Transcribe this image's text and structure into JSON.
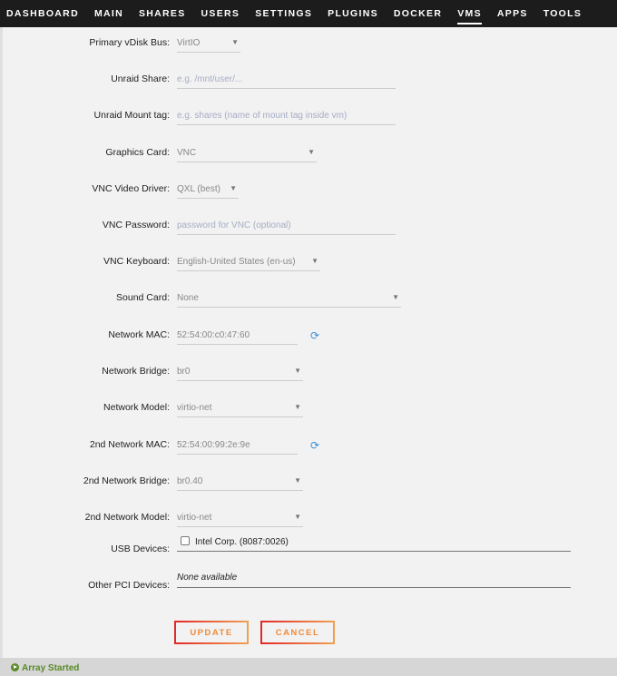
{
  "nav": {
    "items": [
      "DASHBOARD",
      "MAIN",
      "SHARES",
      "USERS",
      "SETTINGS",
      "PLUGINS",
      "DOCKER",
      "VMS",
      "APPS",
      "TOOLS"
    ],
    "active": "VMS"
  },
  "form": {
    "rows": [
      {
        "label": "Primary vDisk Bus:",
        "value": "VirtIO",
        "kind": "select"
      },
      {
        "label": "Unraid Share:",
        "placeholder": "e.g. /mnt/user/...",
        "kind": "input"
      },
      {
        "label": "Unraid Mount tag:",
        "placeholder": "e.g. shares (name of mount tag inside vm)",
        "kind": "input"
      },
      {
        "label": "Graphics Card:",
        "value": "VNC",
        "kind": "select"
      },
      {
        "label": "VNC Video Driver:",
        "value": "QXL (best)",
        "kind": "select"
      },
      {
        "label": "VNC Password:",
        "placeholder": "password for VNC (optional)",
        "kind": "input"
      },
      {
        "label": "VNC Keyboard:",
        "value": "English-United States (en-us)",
        "kind": "select"
      },
      {
        "label": "Sound Card:",
        "value": "None",
        "kind": "select"
      },
      {
        "label": "Network MAC:",
        "value": "52:54:00:c0:47:60",
        "kind": "mac",
        "icon": "refresh-icon"
      },
      {
        "label": "Network Bridge:",
        "value": "br0",
        "kind": "select"
      },
      {
        "label": "Network Model:",
        "value": "virtio-net",
        "kind": "select"
      },
      {
        "label": "2nd Network MAC:",
        "value": "52:54:00:99:2e:9e",
        "kind": "mac",
        "icon": "refresh-icon"
      },
      {
        "label": "2nd Network Bridge:",
        "value": "br0.40",
        "kind": "select"
      },
      {
        "label": "2nd Network Model:",
        "value": "virtio-net",
        "kind": "select"
      },
      {
        "label": "USB Devices:",
        "value": "Intel Corp. (8087:0026)",
        "kind": "checkbox",
        "checked": false
      },
      {
        "label": "Other PCI Devices:",
        "value": "None available",
        "kind": "text"
      }
    ]
  },
  "buttons": {
    "update": "UPDATE",
    "cancel": "CANCEL"
  },
  "footer": {
    "status": "Array Started",
    "color": "#5a8a2a"
  }
}
